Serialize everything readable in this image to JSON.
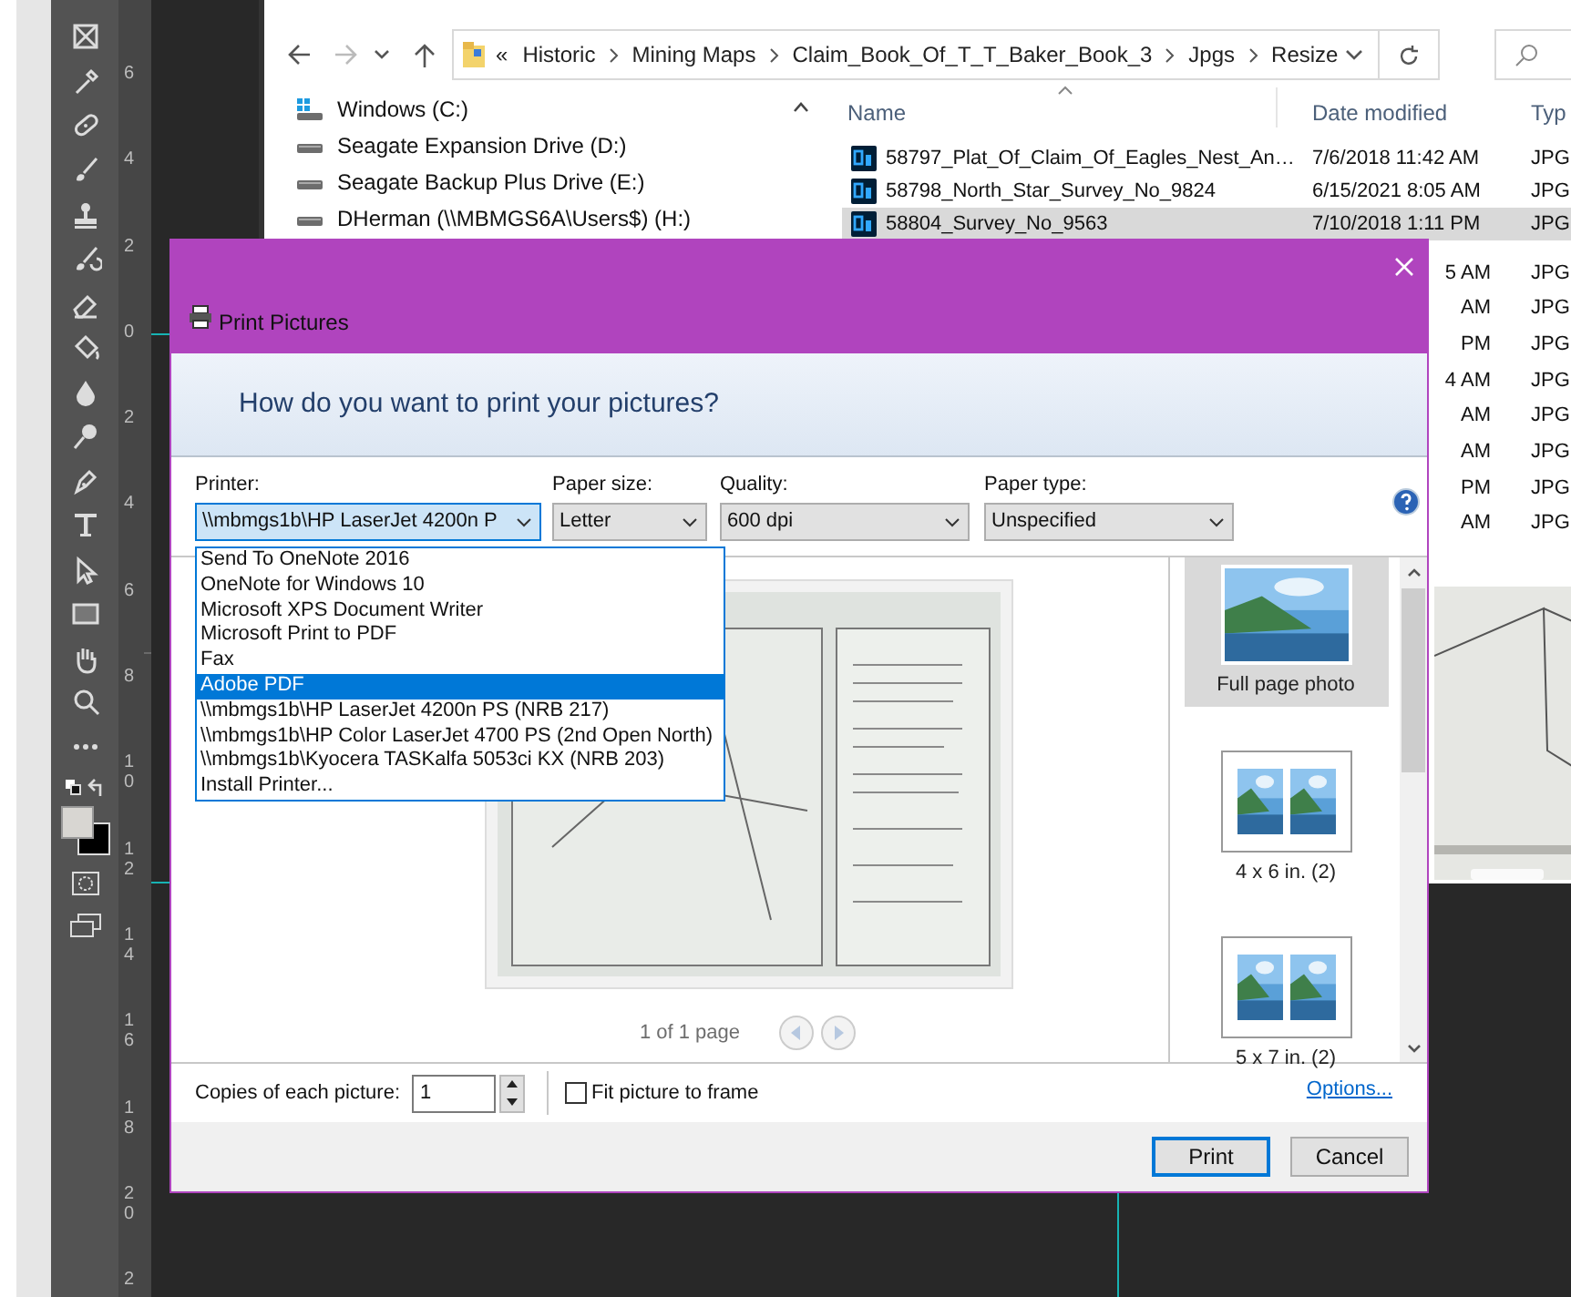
{
  "ruler_numbers": [
    "6",
    "4",
    "2",
    "0",
    "2",
    "4",
    "6",
    "8",
    "10",
    "12",
    "14",
    "16",
    "18",
    "20",
    "2"
  ],
  "explorer": {
    "overflow_mark": "«",
    "address_crumbs": [
      "Historic",
      "Mining Maps",
      "Claim_Book_Of_T_T_Baker_Book_3",
      "Jpgs",
      "Resize"
    ],
    "nav_pane": [
      {
        "label": "Windows  (C:)",
        "kind": "system"
      },
      {
        "label": "Seagate Expansion Drive (D:)",
        "kind": "drive"
      },
      {
        "label": "Seagate Backup Plus Drive (E:)",
        "kind": "drive"
      },
      {
        "label": "DHerman (\\\\MBMGS6A\\Users$) (H:)",
        "kind": "drive"
      }
    ],
    "columns": [
      "Name",
      "Date modified",
      "Typ"
    ],
    "files": [
      {
        "name": "58797_Plat_Of_Claim_Of_Eagles_Nest_An…",
        "date": "7/6/2018 11:42 AM",
        "type": "JPG",
        "selected": false
      },
      {
        "name": "58798_North_Star_Survey_No_9824",
        "date": "6/15/2021 8:05 AM",
        "type": "JPG",
        "selected": false
      },
      {
        "name": "58804_Survey_No_9563",
        "date": "7/10/2018 1:11 PM",
        "type": "JPG",
        "selected": true
      }
    ],
    "partial_rows": [
      {
        "date": "5 AM",
        "type": "JPG"
      },
      {
        "date": "AM",
        "type": "JPG"
      },
      {
        "date": "PM",
        "type": "JPG"
      },
      {
        "date": "4 AM",
        "type": "JPG"
      },
      {
        "date": "AM",
        "type": "JPG"
      },
      {
        "date": "AM",
        "type": "JPG"
      },
      {
        "date": "PM",
        "type": "JPG"
      },
      {
        "date": "AM",
        "type": "JPG"
      }
    ]
  },
  "dialog": {
    "title": "Print Pictures",
    "heading": "How do you want to print your pictures?",
    "fields": [
      {
        "label": "Printer:",
        "value": "\\\\mbmgs1b\\HP LaserJet 4200n P",
        "open": true
      },
      {
        "label": "Paper size:",
        "value": "Letter",
        "open": false
      },
      {
        "label": "Quality:",
        "value": "600 dpi",
        "open": false
      },
      {
        "label": "Paper type:",
        "value": "Unspecified",
        "open": false
      }
    ],
    "printer_options": [
      {
        "label": "Send To OneNote 2016",
        "selected": false
      },
      {
        "label": "OneNote for Windows 10",
        "selected": false
      },
      {
        "label": "Microsoft XPS Document Writer",
        "selected": false
      },
      {
        "label": "Microsoft Print to PDF",
        "selected": false
      },
      {
        "label": "Fax",
        "selected": false
      },
      {
        "label": "Adobe PDF",
        "selected": true
      },
      {
        "label": "\\\\mbmgs1b\\HP LaserJet 4200n PS (NRB 217)",
        "selected": false
      },
      {
        "label": "\\\\mbmgs1b\\HP Color LaserJet 4700 PS (2nd Open North)",
        "selected": false
      },
      {
        "label": "\\\\mbmgs1b\\Kyocera TASKalfa 5053ci KX (NRB 203)",
        "selected": false
      },
      {
        "label": "Install Printer...",
        "selected": false
      }
    ],
    "page_count": "1 of 1 page",
    "layouts": [
      {
        "label": "Full page photo",
        "kind": "full",
        "selected": true
      },
      {
        "label": "4 x 6 in. (2)",
        "kind": "pair",
        "selected": false
      },
      {
        "label": "5 x 7 in. (2)",
        "kind": "pair",
        "selected": false
      }
    ],
    "copies_label": "Copies of each picture:",
    "copies": "1",
    "fit_to_frame": {
      "label": "Fit picture to frame",
      "checked": false
    },
    "options_link": "Options...",
    "buttons": [
      {
        "label": "Print",
        "default": true
      },
      {
        "label": "Cancel",
        "default": false
      }
    ]
  }
}
